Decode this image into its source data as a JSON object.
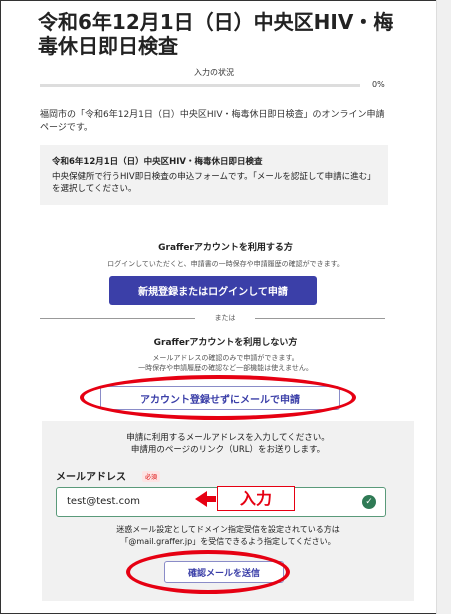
{
  "page": {
    "title": "令和6年12月1日（日）中央区HIV・梅毒休日即日検査"
  },
  "progress": {
    "label": "入力の状況",
    "percent_text": "0%",
    "fraction": 0
  },
  "intro": "福岡市の「令和6年12月1日（日）中央区HIV・梅毒休日即日検査」のオンライン申請ページです。",
  "notice": {
    "title": "令和6年12月1日（日）中央区HIV・梅毒休日即日検査",
    "body": "中央保健所で行うHIV即日検査の申込フォームです。「メールを認証して申請に進む」を選択してください。"
  },
  "with_account": {
    "heading": "Grafferアカウントを利用する方",
    "description": "ログインしていただくと、申請書の一時保存や申請履歴の確認ができます。",
    "button": "新規登録またはログインして申請"
  },
  "divider_text": "または",
  "without_account": {
    "heading": "Grafferアカウントを利用しない方",
    "description_1": "メールアドレスの確認のみで申請ができます。",
    "description_2": "一時保存や申請履歴の確認など一部機能は使えません。",
    "button": "アカウント登録せずにメールで申請"
  },
  "email_form": {
    "instruction_1": "申請に利用するメールアドレスを入力してください。",
    "instruction_2": "申請用のページのリンク（URL）をお送りします。",
    "label": "メールアドレス",
    "required_badge": "必須",
    "value": "test@test.com",
    "annotation": "入力",
    "spam_note_1": "迷惑メール設定としてドメイン指定受信を設定されている方は",
    "spam_note_2": "「@mail.graffer.jp」を受信できるよう指定してください。",
    "send_button": "確認メールを送信"
  },
  "colors": {
    "primary": "#3b3fa8",
    "annotation_red": "#e60012",
    "valid_green": "#2f7a55"
  }
}
